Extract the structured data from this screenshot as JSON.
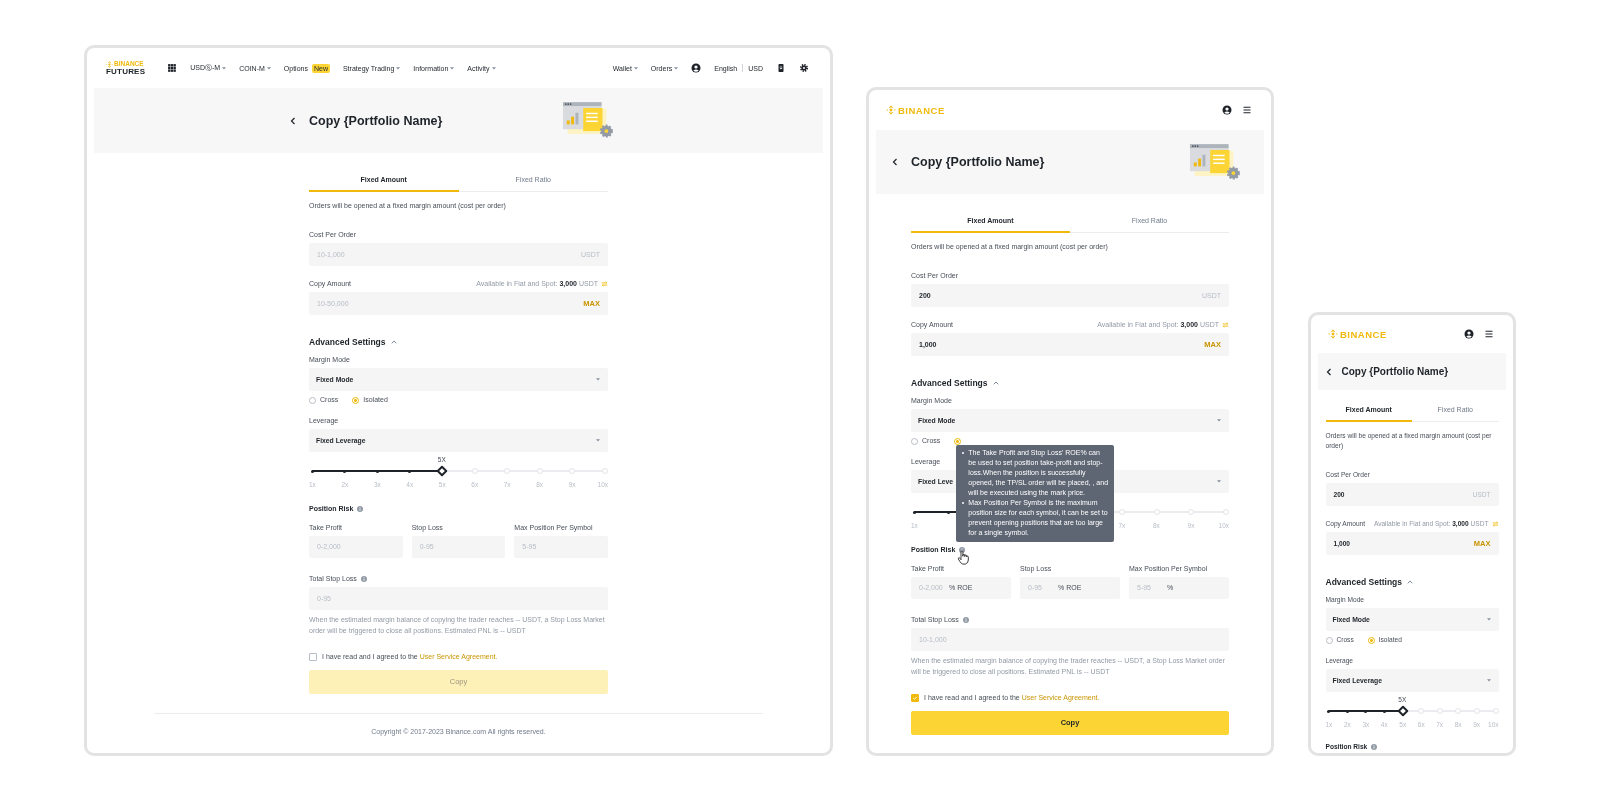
{
  "screens": [
    {
      "kind": "desktop",
      "nav": {
        "logo": {
          "top": "BINANCE",
          "bottom": "FUTURES"
        },
        "items": [
          {
            "label": "USDⓈ-M",
            "dropdown": true
          },
          {
            "label": "COIN-M",
            "dropdown": true
          },
          {
            "label": "Options",
            "dropdown": false,
            "badge": "New"
          },
          {
            "label": "Strategy Trading",
            "dropdown": true
          },
          {
            "label": "Information",
            "dropdown": true
          },
          {
            "label": "Activity",
            "dropdown": true
          }
        ],
        "right_items": [
          {
            "label": "Wallet",
            "dropdown": true
          },
          {
            "label": "Orders",
            "dropdown": true
          }
        ],
        "language": "English",
        "currency": "USD"
      },
      "header": {
        "title": "Copy {Portfolio Name}"
      },
      "form": {
        "tabs": [
          {
            "label": "Fixed Amount",
            "selected": true
          },
          {
            "label": "Fixed Ratio",
            "selected": false
          }
        ],
        "description": "Orders will be opened at a fixed margin amount (cost per order)",
        "cost_per_order": {
          "label": "Cost Per Order",
          "placeholder": "10-1,000",
          "unit": "USDT"
        },
        "copy_amount": {
          "label": "Copy Amount",
          "available": {
            "label": "Available in Fiat and Spot:",
            "amount": "3,000",
            "unit": "USDT"
          },
          "placeholder": "10-50,000",
          "max": "MAX"
        },
        "advanced_settings": {
          "label": "Advanced Settings",
          "expanded": true
        },
        "margin_mode": {
          "label": "Margin Mode",
          "value": "Fixed Mode",
          "options": [
            {
              "label": "Cross",
              "selected": false
            },
            {
              "label": "Isolated",
              "selected": true
            }
          ]
        },
        "leverage": {
          "label": "Leverage",
          "value": "Fixed Leverage",
          "level": 0.444,
          "thumb_label": "5X",
          "ticks": [
            "1x",
            "2x",
            "3x",
            "4x",
            "5x",
            "6x",
            "7x",
            "8x",
            "9x",
            "10x"
          ]
        },
        "position_risk": {
          "label": "Position Risk",
          "fields": [
            {
              "label": "Take Profit",
              "placeholder": "0-2,000"
            },
            {
              "label": "Stop Loss",
              "placeholder": "0-95"
            },
            {
              "label": "Max Position Per Symbol",
              "placeholder": "5-95"
            }
          ]
        },
        "total_stop_loss": {
          "label": "Total Stop Loss",
          "placeholder": "0-95"
        },
        "note": "When the estimated margin balance of copying the trader reaches -- USDT, a Stop Loss Market order will be triggered to close all positions. Estimated PNL is -- USDT",
        "agreement": {
          "checked": false,
          "text": "I have read and I agreed to the",
          "link": "User Service Agreement."
        },
        "copy_button": {
          "label": "Copy",
          "disabled": true
        }
      },
      "footer": "Copyright © 2017-2023 Binance.com All rights reserved."
    },
    {
      "kind": "tablet",
      "logo": "BINANCE",
      "header": {
        "title": "Copy {Portfolio Name}"
      },
      "form": {
        "tabs": [
          {
            "label": "Fixed Amount",
            "selected": true
          },
          {
            "label": "Fixed Ratio",
            "selected": false
          }
        ],
        "description": "Orders will be opened at a fixed margin amount (cost per order)",
        "cost_per_order": {
          "label": "Cost Per Order",
          "value": "200",
          "unit": "USDT"
        },
        "copy_amount": {
          "label": "Copy Amount",
          "available": {
            "label": "Available in Fiat and Spot:",
            "amount": "3,000",
            "unit": "USDT"
          },
          "value": "1,000",
          "max": "MAX"
        },
        "advanced_settings": {
          "label": "Advanced Settings",
          "expanded": true
        },
        "margin_mode": {
          "label": "Margin Mode",
          "value": "Fixed Mode",
          "options": [
            {
              "label": "Cross",
              "selected": false
            },
            {
              "selected": true
            }
          ]
        },
        "leverage": {
          "label": "Leverage",
          "value": "Fixed Leve",
          "level": 0.444,
          "ticks": [
            "1x"
          ],
          "ticks_end": [
            "7x",
            "8x",
            "9x",
            "10x"
          ]
        },
        "position_risk": {
          "label": "Position Risk",
          "tooltip": {
            "bullets": [
              "The Take Profit and Stop Loss' ROE% can be used to set position take-profit and stop-loss.When the position is successfully opened, the TP/SL order will be placed, , and will be executed using the mark price.",
              "Max Position Per Symbol is the maximum position size for each symbol, it can be set to prevent opening positions that are too large for a single symbol."
            ]
          },
          "fields": [
            {
              "label": "Take Profit",
              "placeholder": "0-2,000",
              "suffix": "% ROE"
            },
            {
              "label": "Stop Loss",
              "placeholder": "0-95",
              "suffix": "% ROE"
            },
            {
              "label": "Max Position Per Symbol",
              "placeholder": "5-95",
              "suffix": "%"
            }
          ]
        },
        "total_stop_loss": {
          "label": "Total Stop Loss",
          "placeholder": "10-1,000"
        },
        "note": "When the estimated margin balance of copying the trader reaches -- USDT, a Stop Loss Market order will be triggered to close all positions. Estimated PNL is -- USDT",
        "agreement": {
          "checked": true,
          "text": "I have read and I agreed to the",
          "link": "User Service Agreement."
        },
        "copy_button": {
          "label": "Copy",
          "disabled": false
        }
      }
    },
    {
      "kind": "mobile",
      "logo": "BINANCE",
      "header": {
        "title": "Copy {Portfolio Name}"
      },
      "form": {
        "tabs": [
          {
            "label": "Fixed Amount",
            "selected": true
          },
          {
            "label": "Fixed Ratio",
            "selected": false
          }
        ],
        "description": "Orders will be opened at a fixed margin amount (cost per order)",
        "cost_per_order": {
          "label": "Cost Per Order",
          "value": "200",
          "unit": "USDT"
        },
        "copy_amount": {
          "label": "Copy Amount",
          "available": {
            "label": "Available in Fiat and Spot:",
            "amount": "3,000",
            "unit": "USDT"
          },
          "value": "1,000",
          "max": "MAX"
        },
        "advanced_settings": {
          "label": "Advanced Settings",
          "expanded": true
        },
        "margin_mode": {
          "label": "Margin Mode",
          "value": "Fixed Mode",
          "options": [
            {
              "label": "Cross",
              "selected": false
            },
            {
              "label": "Isolated",
              "selected": true
            }
          ]
        },
        "leverage": {
          "label": "Leverage",
          "value": "Fixed Leverage",
          "level": 0.444,
          "thumb_label": "5X",
          "ticks": [
            "1x",
            "2x",
            "3x",
            "4x",
            "5x",
            "6x",
            "7x",
            "8x",
            "9x",
            "10x"
          ]
        },
        "position_risk": {
          "label": "Position Risk"
        }
      }
    }
  ]
}
